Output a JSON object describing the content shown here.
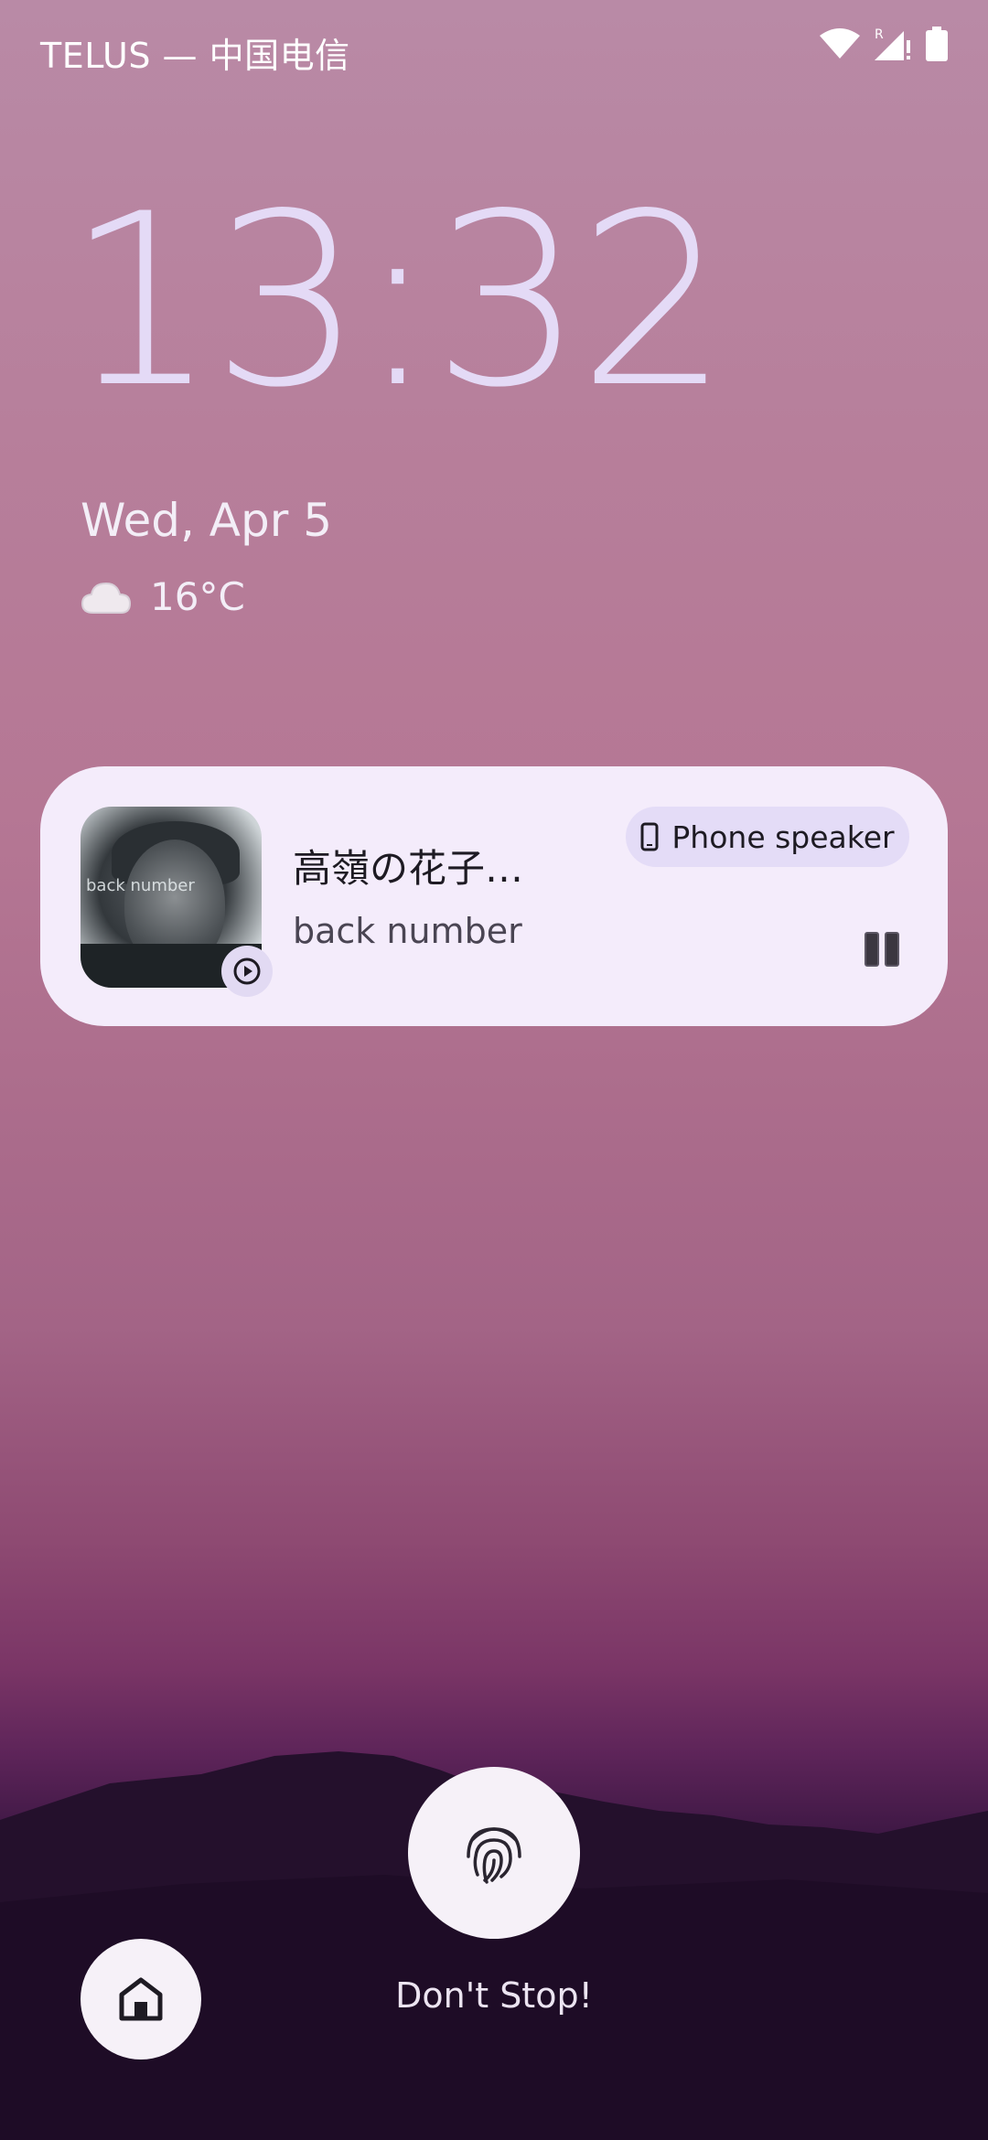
{
  "status_bar": {
    "carrier": "TELUS — 中国电信",
    "icons": [
      "wifi-icon",
      "signal-roaming-icon",
      "battery-icon"
    ],
    "roaming_label": "R"
  },
  "lockscreen": {
    "time": "13:32",
    "date": "Wed, Apr 5",
    "weather": {
      "icon": "cloud-icon",
      "temperature": "16°C"
    }
  },
  "media_player": {
    "title": "高嶺の花子…",
    "artist": "back number",
    "album_art_text": "back number",
    "output_device": "Phone speaker",
    "output_icon": "phone-icon",
    "state": "playing",
    "colors": {
      "card": "#f4ecfb",
      "chip": "#e4dcf7"
    }
  },
  "bottom": {
    "owner_info": "Don't Stop!",
    "fingerprint_icon": "fingerprint-icon",
    "home_icon": "home-icon"
  }
}
